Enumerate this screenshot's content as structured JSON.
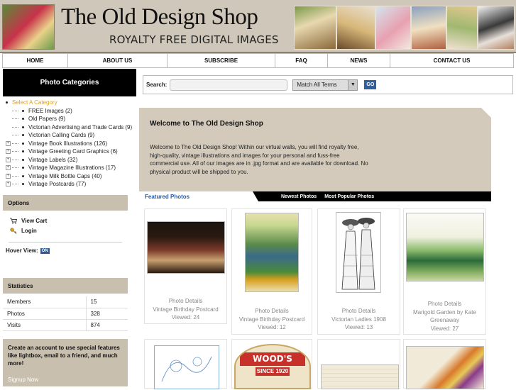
{
  "header": {
    "title": "The Old Design Shop",
    "subtitle": "ROYALTY FREE DIGITAL IMAGES"
  },
  "nav": [
    {
      "label": "HOME"
    },
    {
      "label": "ABOUT US"
    },
    {
      "label": "SUBSCRIBE"
    },
    {
      "label": "FAQ"
    },
    {
      "label": "NEWS"
    },
    {
      "label": "CONTACT US"
    }
  ],
  "sidebar": {
    "categories_title": "Photo Categories",
    "root_label": "Select A Category",
    "categories": [
      {
        "label": "FREE Images (2)",
        "expandable": false
      },
      {
        "label": "Old Papers (9)",
        "expandable": false
      },
      {
        "label": "Victorian Advertising and Trade Cards (9)",
        "expandable": false
      },
      {
        "label": "Victorian Calling Cards (9)",
        "expandable": false
      },
      {
        "label": "Vintage Book Illustrations (126)",
        "expandable": true
      },
      {
        "label": "Vintage Greeting Card Graphics (6)",
        "expandable": true
      },
      {
        "label": "Vintage Labels (32)",
        "expandable": true
      },
      {
        "label": "Vintage Magazine Illustrations (17)",
        "expandable": true
      },
      {
        "label": "Vintage Milk Bottle Caps (40)",
        "expandable": true
      },
      {
        "label": "Vintage Postcards (77)",
        "expandable": true
      }
    ],
    "options_title": "Options",
    "view_cart": "View Cart",
    "login": "Login",
    "hover_view_label": "Hover View:",
    "hover_view_state": "ON",
    "statistics_title": "Statistics",
    "stats": [
      {
        "label": "Members",
        "value": "15"
      },
      {
        "label": "Photos",
        "value": "328"
      },
      {
        "label": "Visits",
        "value": "874"
      }
    ],
    "promo_text": "Create an account to use special features like lightbox, email to a friend, and much more!",
    "signup_label": "Signup Now"
  },
  "search": {
    "label": "Search:",
    "value": "",
    "match_option": "Match All Terms",
    "go_label": "GO"
  },
  "welcome": {
    "title": "Welcome to The Old Design Shop",
    "body": "Welcome to The Old Design Shop! Within our virtual walls, you will find royalty free, high-quality, vintage illustrations and images for your personal and fuss-free commercial use. All of our images are in .jpg format and are available for download. No physical product will be shipped to you."
  },
  "tabs": {
    "featured": "Featured Photos",
    "newest": "Newest Photos",
    "popular": "Most Popular Photos"
  },
  "photos": [
    {
      "details": "Photo Details",
      "title": "Vintage Birthday Postcard",
      "views": "Viewed: 24"
    },
    {
      "details": "Photo Details",
      "title": "Vintage Birthday Postcard",
      "views": "Viewed: 12"
    },
    {
      "details": "Photo Details",
      "title": "Victorian Ladies 1908",
      "views": "Viewed: 13"
    },
    {
      "details": "Photo Details",
      "title": "Marigold Garden by Kate Greenaway",
      "views": "Viewed: 27"
    }
  ],
  "bottom_thumbs": {
    "label_woods": "WOOD'S DAIRY",
    "label_since": "SINCE 1920"
  },
  "colors": {
    "header_bg": "#cfc7b9",
    "sidebar_head": "#000000",
    "section_head": "#c9bfae",
    "link_blue": "#2a5aa0",
    "root_orange": "#e0a020"
  }
}
